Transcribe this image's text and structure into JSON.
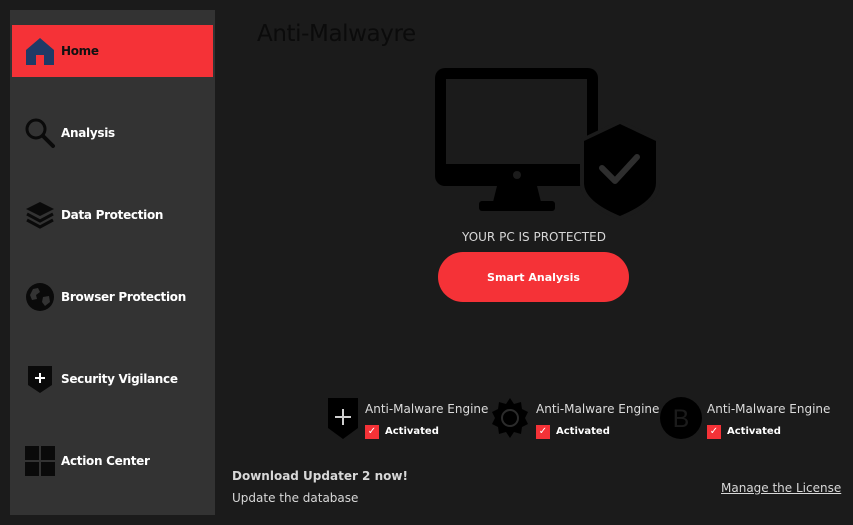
{
  "app": {
    "title": "Anti-Malwayre"
  },
  "sidebar": {
    "items": [
      {
        "label": "Home",
        "icon": "home-icon",
        "active": true
      },
      {
        "label": "Analysis",
        "icon": "search-icon",
        "active": false
      },
      {
        "label": "Data Protection",
        "icon": "layers-icon",
        "active": false
      },
      {
        "label": "Browser Protection",
        "icon": "globe-icon",
        "active": false
      },
      {
        "label": "Security Vigilance",
        "icon": "shield-plus-icon",
        "active": false
      },
      {
        "label": "Action Center",
        "icon": "grid-icon",
        "active": false
      }
    ]
  },
  "main": {
    "hero_icon": "monitor-shield-check-icon",
    "status": "YOUR PC IS PROTECTED",
    "smart_button": "Smart Analysis"
  },
  "engines": [
    {
      "name": "Anti-Malware Engine",
      "status": "Activated",
      "icon": "shield-plus-icon",
      "checked": true
    },
    {
      "name": "Anti-Malware Engine",
      "status": "Activated",
      "icon": "gear-shield-icon",
      "checked": true
    },
    {
      "name": "Anti-Malware Engine",
      "status": "Activated",
      "icon": "circle-b-icon",
      "checked": true
    }
  ],
  "footer": {
    "update_title": "Download Updater 2 now!",
    "update_subtitle": "Update the database",
    "license_link": "Manage the License"
  },
  "colors": {
    "accent": "#f53237",
    "background": "#1b1b1b",
    "sidebar": "#333333",
    "active_icon": "#1f3a66"
  }
}
